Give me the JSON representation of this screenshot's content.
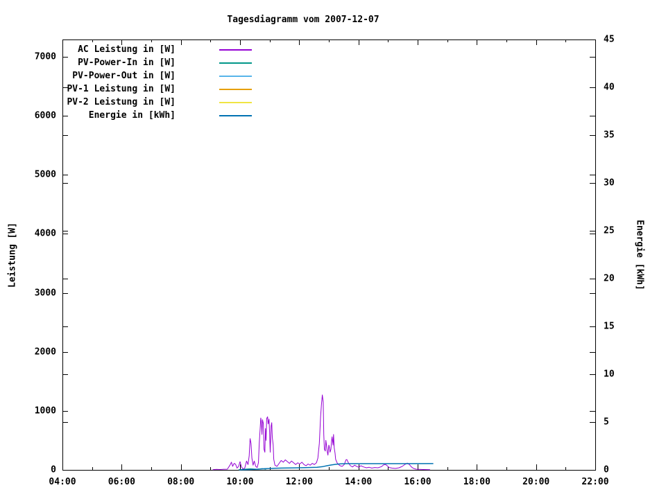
{
  "title": "Tagesdiagramm vom 2007-12-07",
  "axes": {
    "ylabel_left": "Leistung [W]",
    "ylabel_right": "Energie [kWh]"
  },
  "legend": {
    "items": [
      {
        "label": "AC Leistung in [W]",
        "color": "#9400d3"
      },
      {
        "label": "PV-Power-In in [W]",
        "color": "#009688"
      },
      {
        "label": "PV-Power-Out in [W]",
        "color": "#56b4e9"
      },
      {
        "label": "PV-1 Leistung in [W]",
        "color": "#e69f00"
      },
      {
        "label": "PV-2 Leistung in [W]",
        "color": "#f0e442"
      },
      {
        "label": "Energie in [kWh]",
        "color": "#0072b2"
      }
    ]
  },
  "chart_data": {
    "type": "line",
    "title": "Tagesdiagramm vom 2007-12-07",
    "xlabel": "",
    "ylabel_left": "Leistung [W]",
    "ylabel_right": "Energie [kWh]",
    "xlim": [
      4,
      22
    ],
    "ylim_left": [
      0,
      7295
    ],
    "ylim_right": [
      0,
      45
    ],
    "grid": false,
    "legend_position": "top-left-inside",
    "x_ticks": {
      "values": [
        4,
        6,
        8,
        10,
        12,
        14,
        16,
        18,
        20,
        22
      ],
      "labels": [
        "04:00",
        "06:00",
        "08:00",
        "10:00",
        "12:00",
        "14:00",
        "16:00",
        "18:00",
        "20:00",
        "22:00"
      ]
    },
    "x_minor_ticks": [
      5,
      7,
      9,
      11,
      13,
      15,
      17,
      19,
      21
    ],
    "y_left_ticks": {
      "values": [
        0,
        1000,
        2000,
        3000,
        4000,
        5000,
        6000,
        7000
      ],
      "labels": [
        "0",
        "1000",
        "2000",
        "3000",
        "4000",
        "5000",
        "6000",
        "7000"
      ]
    },
    "y_right_ticks": {
      "values": [
        0,
        5,
        10,
        15,
        20,
        25,
        30,
        35,
        40,
        45
      ],
      "labels": [
        "0",
        "5",
        "10",
        "15",
        "20",
        "25",
        "30",
        "35",
        "40",
        "45"
      ]
    },
    "series": [
      {
        "name": "AC Leistung in [W]",
        "color": "#9400d3",
        "axis": "left",
        "points": [
          [
            9.08,
            4
          ],
          [
            9.2,
            8
          ],
          [
            9.33,
            6
          ],
          [
            9.45,
            10
          ],
          [
            9.57,
            12
          ],
          [
            9.66,
            80
          ],
          [
            9.71,
            130
          ],
          [
            9.75,
            60
          ],
          [
            9.8,
            110
          ],
          [
            9.85,
            95
          ],
          [
            9.9,
            30
          ],
          [
            9.95,
            60
          ],
          [
            10.0,
            140
          ],
          [
            10.05,
            50
          ],
          [
            10.1,
            15
          ],
          [
            10.16,
            30
          ],
          [
            10.22,
            150
          ],
          [
            10.27,
            90
          ],
          [
            10.31,
            240
          ],
          [
            10.34,
            530
          ],
          [
            10.37,
            450
          ],
          [
            10.4,
            200
          ],
          [
            10.44,
            80
          ],
          [
            10.48,
            150
          ],
          [
            10.53,
            60
          ],
          [
            10.58,
            40
          ],
          [
            10.62,
            120
          ],
          [
            10.65,
            450
          ],
          [
            10.68,
            700
          ],
          [
            10.7,
            880
          ],
          [
            10.72,
            820
          ],
          [
            10.74,
            600
          ],
          [
            10.76,
            850
          ],
          [
            10.79,
            780
          ],
          [
            10.81,
            350
          ],
          [
            10.84,
            300
          ],
          [
            10.86,
            700
          ],
          [
            10.88,
            500
          ],
          [
            10.9,
            870
          ],
          [
            10.93,
            900
          ],
          [
            10.95,
            780
          ],
          [
            10.98,
            860
          ],
          [
            11.0,
            600
          ],
          [
            11.02,
            300
          ],
          [
            11.05,
            740
          ],
          [
            11.07,
            800
          ],
          [
            11.09,
            550
          ],
          [
            11.12,
            420
          ],
          [
            11.14,
            180
          ],
          [
            11.18,
            80
          ],
          [
            11.25,
            60
          ],
          [
            11.32,
            110
          ],
          [
            11.39,
            160
          ],
          [
            11.46,
            130
          ],
          [
            11.53,
            170
          ],
          [
            11.6,
            140
          ],
          [
            11.67,
            110
          ],
          [
            11.74,
            150
          ],
          [
            11.81,
            120
          ],
          [
            11.88,
            90
          ],
          [
            11.95,
            120
          ],
          [
            12.02,
            100
          ],
          [
            12.09,
            130
          ],
          [
            12.16,
            90
          ],
          [
            12.23,
            70
          ],
          [
            12.3,
            100
          ],
          [
            12.37,
            80
          ],
          [
            12.44,
            110
          ],
          [
            12.51,
            90
          ],
          [
            12.58,
            120
          ],
          [
            12.63,
            200
          ],
          [
            12.68,
            450
          ],
          [
            12.72,
            900
          ],
          [
            12.75,
            1100
          ],
          [
            12.78,
            1270
          ],
          [
            12.81,
            1150
          ],
          [
            12.83,
            600
          ],
          [
            12.85,
            350
          ],
          [
            12.88,
            320
          ],
          [
            12.9,
            500
          ],
          [
            12.92,
            420
          ],
          [
            12.95,
            300
          ],
          [
            12.97,
            250
          ],
          [
            13.0,
            420
          ],
          [
            13.02,
            380
          ],
          [
            13.04,
            300
          ],
          [
            13.07,
            350
          ],
          [
            13.09,
            480
          ],
          [
            13.11,
            560
          ],
          [
            13.14,
            420
          ],
          [
            13.16,
            600
          ],
          [
            13.18,
            380
          ],
          [
            13.21,
            280
          ],
          [
            13.23,
            180
          ],
          [
            13.28,
            120
          ],
          [
            13.33,
            90
          ],
          [
            13.38,
            70
          ],
          [
            13.45,
            60
          ],
          [
            13.52,
            90
          ],
          [
            13.58,
            170
          ],
          [
            13.61,
            175
          ],
          [
            13.66,
            120
          ],
          [
            13.73,
            70
          ],
          [
            13.8,
            50
          ],
          [
            13.87,
            80
          ],
          [
            13.94,
            60
          ],
          [
            14.01,
            45
          ],
          [
            14.08,
            70
          ],
          [
            14.17,
            50
          ],
          [
            14.27,
            35
          ],
          [
            14.36,
            45
          ],
          [
            14.45,
            30
          ],
          [
            14.55,
            40
          ],
          [
            14.66,
            35
          ],
          [
            14.78,
            55
          ],
          [
            14.85,
            85
          ],
          [
            14.92,
            90
          ],
          [
            14.97,
            70
          ],
          [
            15.04,
            40
          ],
          [
            15.13,
            30
          ],
          [
            15.25,
            25
          ],
          [
            15.37,
            35
          ],
          [
            15.48,
            60
          ],
          [
            15.58,
            95
          ],
          [
            15.65,
            115
          ],
          [
            15.72,
            90
          ],
          [
            15.79,
            50
          ],
          [
            15.86,
            25
          ],
          [
            15.95,
            12
          ],
          [
            16.07,
            8
          ],
          [
            16.19,
            6
          ],
          [
            16.31,
            5
          ],
          [
            16.42,
            4
          ]
        ]
      },
      {
        "name": "PV-Power-In in [W]",
        "color": "#009688",
        "axis": "left",
        "points": [
          [
            9.95,
            2
          ],
          [
            10.15,
            12
          ],
          [
            10.35,
            20
          ],
          [
            10.55,
            12
          ],
          [
            10.75,
            22
          ],
          [
            10.88,
            8
          ]
        ]
      },
      {
        "name": "PV-Power-Out in [W]",
        "color": "#56b4e9",
        "axis": "left",
        "points": []
      },
      {
        "name": "PV-1 Leistung in [W]",
        "color": "#e69f00",
        "axis": "left",
        "points": []
      },
      {
        "name": "PV-2 Leistung in [W]",
        "color": "#f0e442",
        "axis": "left",
        "points": []
      },
      {
        "name": "Energie in [kWh]",
        "color": "#0072b2",
        "axis": "right",
        "points": [
          [
            9.97,
            0.0
          ],
          [
            10.3,
            0.03
          ],
          [
            10.6,
            0.07
          ],
          [
            10.85,
            0.13
          ],
          [
            11.1,
            0.17
          ],
          [
            11.4,
            0.19
          ],
          [
            11.8,
            0.21
          ],
          [
            12.2,
            0.23
          ],
          [
            12.6,
            0.27
          ],
          [
            12.8,
            0.35
          ],
          [
            12.95,
            0.44
          ],
          [
            13.1,
            0.52
          ],
          [
            13.25,
            0.59
          ],
          [
            13.4,
            0.63
          ],
          [
            13.6,
            0.65
          ],
          [
            14.5,
            0.65
          ],
          [
            15.5,
            0.65
          ],
          [
            16.53,
            0.66
          ]
        ]
      }
    ]
  }
}
